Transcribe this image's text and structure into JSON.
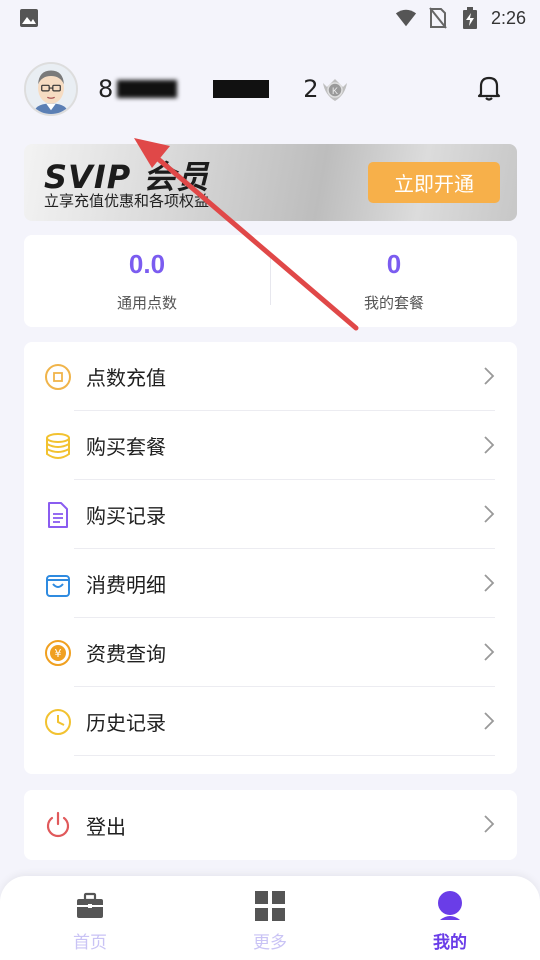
{
  "status_bar": {
    "time": "2:26",
    "icons": [
      "image-icon",
      "wifi-icon",
      "no-sim-icon",
      "battery-charging-icon"
    ]
  },
  "profile": {
    "username_visible": "8",
    "level": "2",
    "avatar_icon": "avatar",
    "bell_icon": "bell-icon"
  },
  "svip": {
    "title": "SVIP 会员",
    "subtitle": "立享充值优惠和各项权益",
    "button": "立即开通"
  },
  "stats": [
    {
      "value": "0.0",
      "label": "通用点数"
    },
    {
      "value": "0",
      "label": "我的套餐"
    }
  ],
  "menu": [
    {
      "label": "点数充值",
      "icon": "coin-icon"
    },
    {
      "label": "购买套餐",
      "icon": "database-icon"
    },
    {
      "label": "购买记录",
      "icon": "document-icon"
    },
    {
      "label": "消费明细",
      "icon": "shopping-bag-icon"
    },
    {
      "label": "资费查询",
      "icon": "yen-icon"
    },
    {
      "label": "历史记录",
      "icon": "clock-icon"
    }
  ],
  "logout": {
    "label": "登出",
    "icon": "power-icon"
  },
  "bottom_nav": [
    {
      "label": "首页",
      "icon": "briefcase-icon",
      "active": false
    },
    {
      "label": "更多",
      "icon": "grid-icon",
      "active": false
    },
    {
      "label": "我的",
      "icon": "user-icon",
      "active": true
    }
  ],
  "colors": {
    "accent": "#7b5cf0",
    "nav_active": "#6a3de8",
    "svip_button": "#f7b04a",
    "annotation_arrow": "#e04848"
  }
}
